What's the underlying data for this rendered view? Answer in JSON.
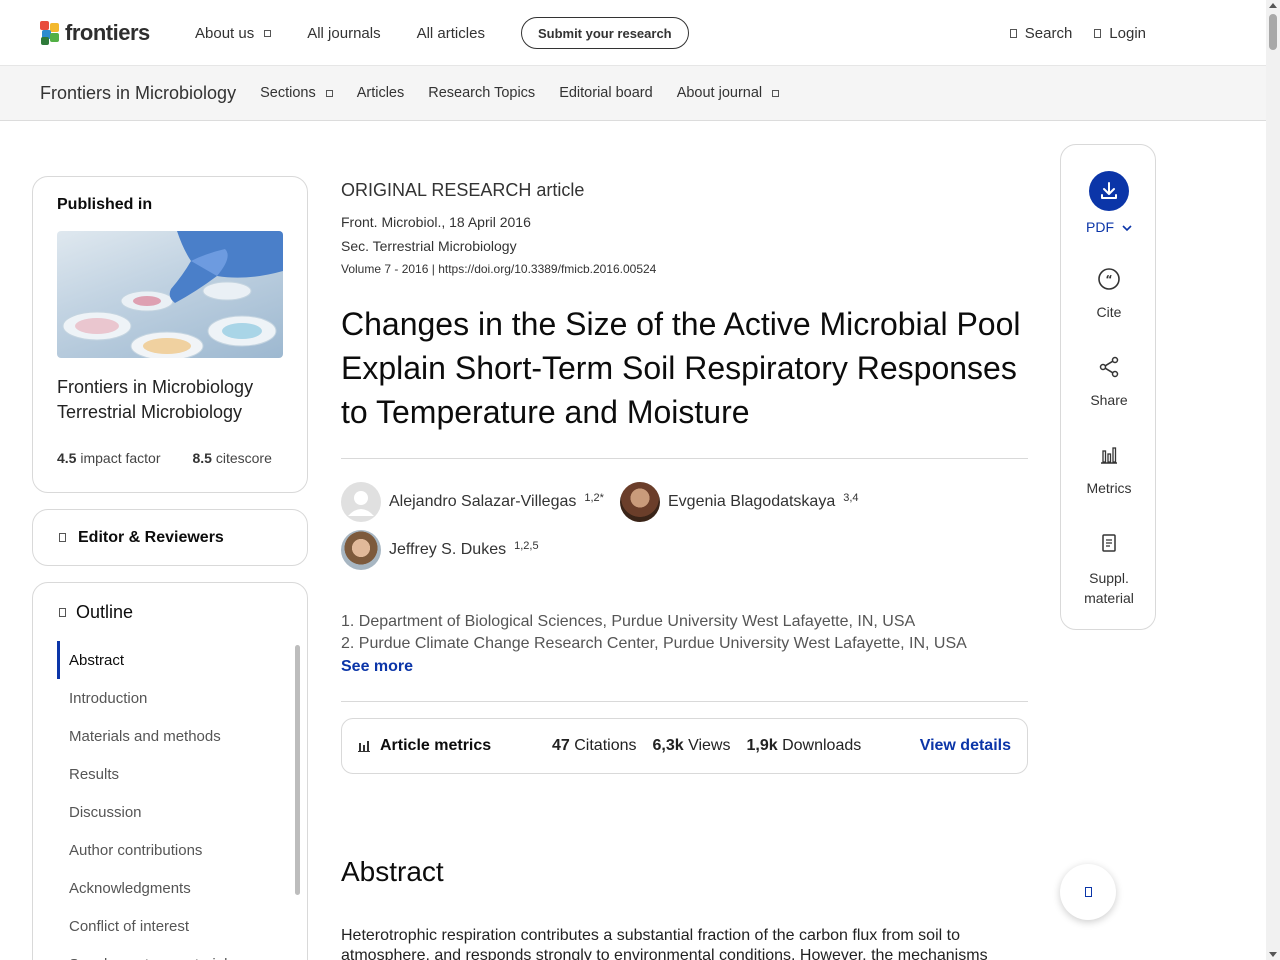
{
  "header": {
    "logo_text": "frontiers",
    "nav": [
      "About us",
      "All journals",
      "All articles"
    ],
    "submit_label": "Submit your research",
    "search_label": "Search",
    "login_label": "Login"
  },
  "journal_bar": {
    "name": "Frontiers in Microbiology",
    "nav": [
      "Sections",
      "Articles",
      "Research Topics",
      "Editorial board",
      "About journal"
    ]
  },
  "sidebar": {
    "published_in_label": "Published in",
    "journal": "Frontiers in Microbiology",
    "section": "Terrestrial Microbiology",
    "impact_factor_value": "4.5",
    "impact_factor_label": "impact factor",
    "citescore_value": "8.5",
    "citescore_label": "citescore",
    "editor_label": "Editor & Reviewers",
    "outline_label": "Outline",
    "outline": [
      "Abstract",
      "Introduction",
      "Materials and methods",
      "Results",
      "Discussion",
      "Author contributions",
      "Acknowledgments",
      "Conflict of interest",
      "Supplementary material"
    ]
  },
  "article": {
    "type": "ORIGINAL RESEARCH article",
    "journal_date": "Front. Microbiol., 18 April 2016",
    "section": "Sec. Terrestrial Microbiology",
    "volume": "Volume 7 - 2016 |",
    "doi": "https://doi.org/10.3389/fmicb.2016.00524",
    "title": "Changes in the Size of the Active Microbial Pool Explain Short-Term Soil Respiratory Responses to Temperature and Moisture",
    "authors": [
      {
        "name": "Alejandro Salazar-Villegas",
        "sup": "1,2*"
      },
      {
        "name": "Evgenia Blagodatskaya",
        "sup": "3,4"
      },
      {
        "name": "Jeffrey S. Dukes",
        "sup": "1,2,5"
      }
    ],
    "affiliations": [
      "1. Department of Biological Sciences, Purdue University West Lafayette, IN, USA",
      "2. Purdue Climate Change Research Center, Purdue University West Lafayette, IN, USA"
    ],
    "see_more": "See more",
    "metrics": {
      "label": "Article metrics",
      "citations_value": "47",
      "citations_label": "Citations",
      "views_value": "6,3k",
      "views_label": "Views",
      "downloads_value": "1,9k",
      "downloads_label": "Downloads",
      "details_label": "View details"
    },
    "abstract_heading": "Abstract",
    "abstract_text": "Heterotrophic respiration contributes a substantial fraction of the carbon flux from soil to atmosphere, and responds strongly to environmental conditions. However, the mechanisms"
  },
  "tools": {
    "pdf": "PDF",
    "cite": "Cite",
    "share": "Share",
    "metrics": "Metrics",
    "suppl": "Suppl. material"
  },
  "colors": {
    "accent": "#0b35a8"
  }
}
